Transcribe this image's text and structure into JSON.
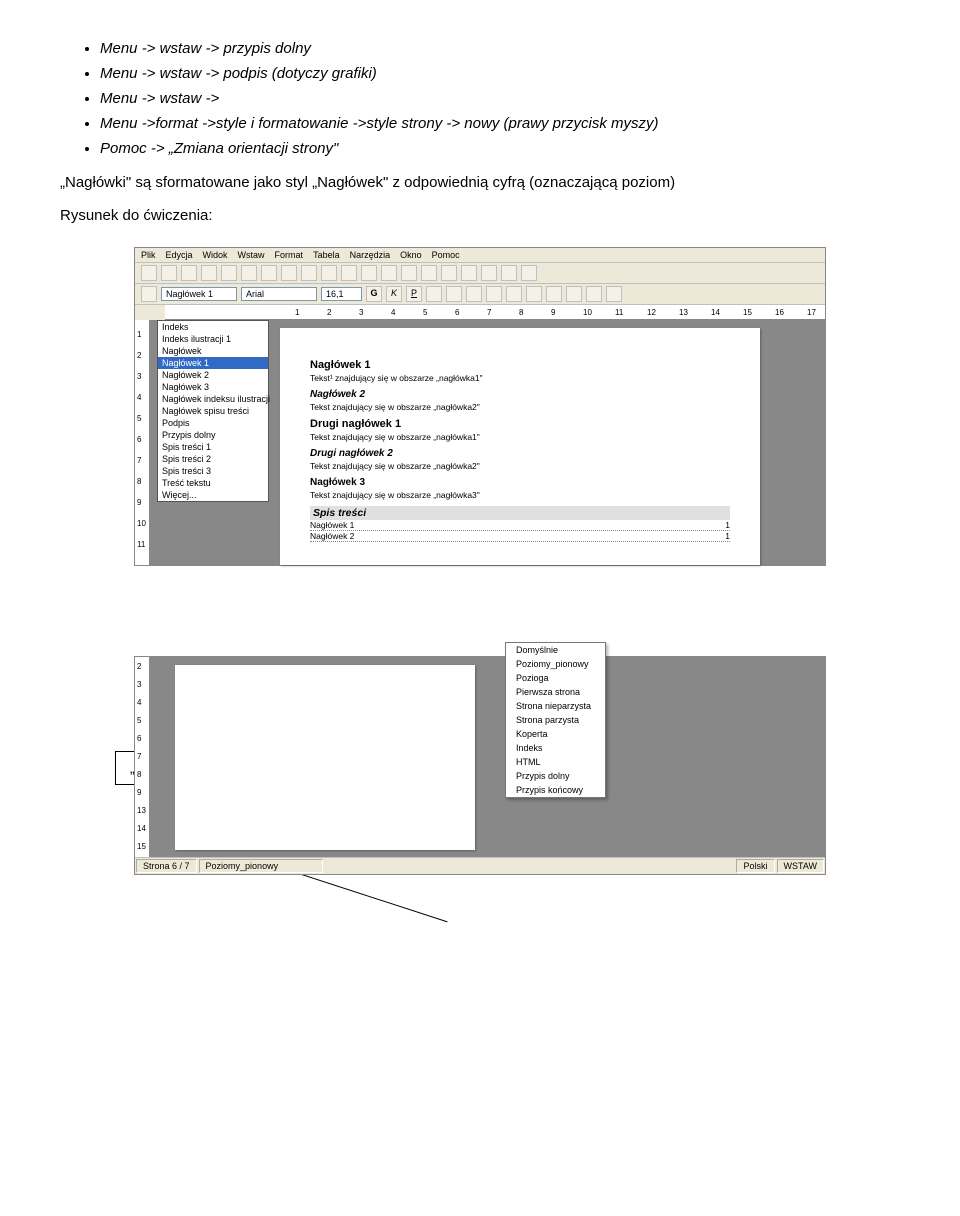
{
  "bullets": {
    "b1": "Menu -> wstaw -> przypis dolny",
    "b2": "Menu -> wstaw -> podpis (dotyczy grafiki)",
    "b3": "Menu -> wstaw ->",
    "b4": "Menu ->format ->style i formatowanie ->style strony -> nowy (prawy przycisk myszy)",
    "b5": "Pomoc -> „Zmiana orientacji strony\""
  },
  "para1": "„Nagłówki\" są sformatowane jako styl „Nagłówek\" z odpowiednią cyfrą (oznaczającą poziom)",
  "para2": "Rysunek do ćwiczenia:",
  "screenshot1": {
    "menubar": [
      "Plik",
      "Edycja",
      "Widok",
      "Wstaw",
      "Format",
      "Tabela",
      "Narzędzia",
      "Okno",
      "Pomoc"
    ],
    "style_combo": "Nagłówek 1",
    "font_combo": "Arial",
    "size_combo": "16,1",
    "bold": "G",
    "italic": "K",
    "underline": "P",
    "ruler_marks": [
      "1",
      "2",
      "3",
      "4",
      "5",
      "6",
      "7",
      "8",
      "9",
      "10",
      "11",
      "12",
      "13",
      "14",
      "15",
      "16",
      "17"
    ],
    "vruler_marks": [
      "1",
      "2",
      "3",
      "4",
      "5",
      "6",
      "7",
      "8",
      "9",
      "10",
      "11"
    ],
    "styles": [
      "Indeks",
      "Indeks ilustracji 1",
      "Nagłówek",
      "Nagłówek 1",
      "Nagłówek 2",
      "Nagłówek 3",
      "Nagłówek indeksu ilustracji",
      "Nagłówek spisu treści",
      "Podpis",
      "Przypis dolny",
      "Spis treści 1",
      "Spis treści 2",
      "Spis treści 3",
      "Treść tekstu",
      "Więcej..."
    ],
    "styles_selected_index": 3,
    "doc": {
      "h1a": "Nagłówek 1",
      "t1": "Tekst¹ znajdujący się w obszarze „nagłówka1\"",
      "h2a": "Nagłówek 2",
      "t2": "Tekst znajdujący się w obszarze „nagłówka2\"",
      "h1b": "Drugi nagłówek 1",
      "t3": "Tekst znajdujący się w obszarze „nagłówka1\"",
      "h2b": "Drugi nagłówek 2",
      "t4": "Tekst znajdujący się w obszarze „nagłówka2\"",
      "h3a": "Nagłówek 3",
      "t5": "Tekst znajdujący się w obszarze „nagłówka3\"",
      "toc_head": "Spis treści",
      "toc": [
        {
          "label": "Nagłówek 1",
          "page": "1"
        },
        {
          "label": "Nagłówek 2",
          "page": "1"
        }
      ]
    }
  },
  "screenshot2": {
    "vruler_marks": [
      "2",
      "3",
      "4",
      "5",
      "6",
      "7",
      "8",
      "9",
      "13",
      "14",
      "15"
    ],
    "context": [
      "Domyślnie",
      "Poziomy_pionowy",
      "Pozioga",
      "Pierwsza strona",
      "Strona nieparzysta",
      "Strona parzysta",
      "Koperta",
      "Indeks",
      "HTML",
      "Przypis dolny",
      "Przypis końcowy"
    ],
    "status": {
      "page": "Strona 6 / 7",
      "style": "Poziomy_pionowy",
      "lang": "Polski",
      "mode": "WSTAW"
    }
  },
  "callout": "„prawy/lewy przycisk myszy\""
}
